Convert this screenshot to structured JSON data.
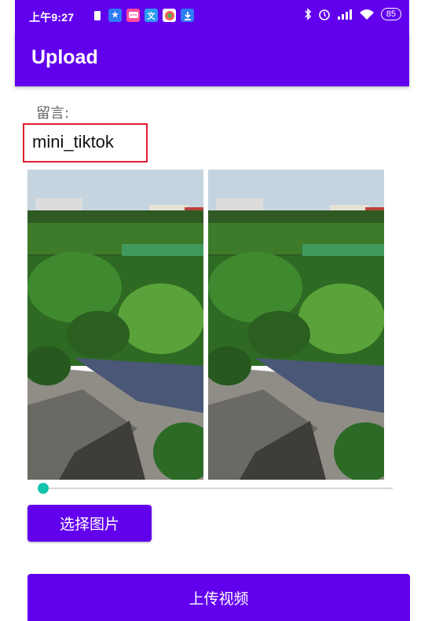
{
  "status_bar": {
    "time": "上午9:27",
    "battery": "85",
    "icons_left": [
      "sim-icon",
      "app-star-icon",
      "message-icon",
      "translate-icon",
      "browser-icon",
      "download-icon"
    ],
    "icons_right": [
      "bluetooth-icon",
      "alarm-icon",
      "signal-icon",
      "wifi-icon",
      "battery-icon"
    ]
  },
  "app_bar": {
    "title": "Upload"
  },
  "message": {
    "label": "留言:",
    "value": "mini_tiktok"
  },
  "slider": {
    "value": 0.0
  },
  "buttons": {
    "pick_image": "选择图片",
    "upload_video": "上传视频"
  },
  "colors": {
    "primary": "#6200ee",
    "accent": "#13c3ad",
    "input_border": "#e01e2d"
  }
}
